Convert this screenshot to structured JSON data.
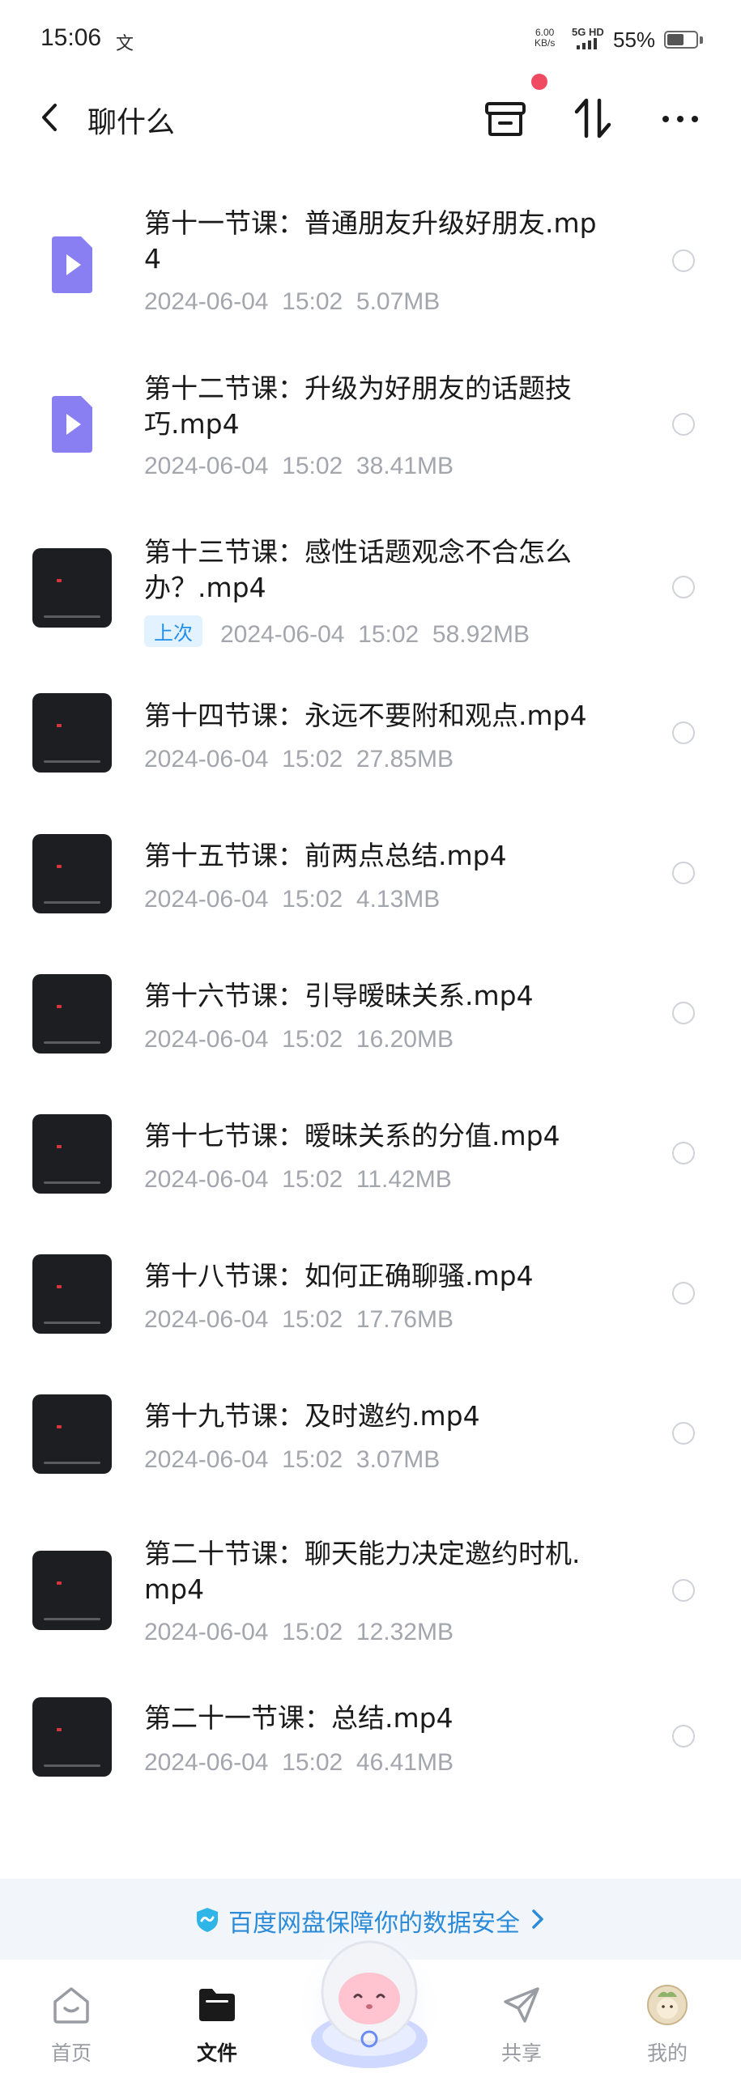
{
  "status_bar": {
    "time": "15:06",
    "notif_icon": "文",
    "net_speed_value": "6.00",
    "net_speed_unit": "KB/s",
    "signal": "5G HD",
    "battery": "55%"
  },
  "header": {
    "title": "聊什么"
  },
  "files": [
    {
      "name": "第十一节课：普通朋友升级好朋友.mp4",
      "date": "2024-06-04",
      "time": "15:02",
      "size": "5.07MB",
      "thumb": "doc-video-icon"
    },
    {
      "name": "第十二节课：升级为好朋友的话题技巧.mp4",
      "date": "2024-06-04",
      "time": "15:02",
      "size": "38.41MB",
      "thumb": "doc-video-icon"
    },
    {
      "name": "第十三节课：感性话题观念不合怎么办？.mp4",
      "date": "2024-06-04",
      "time": "15:02",
      "size": "58.92MB",
      "thumb": "video-thumbnail",
      "badge": "上次"
    },
    {
      "name": "第十四节课：永远不要附和观点.mp4",
      "date": "2024-06-04",
      "time": "15:02",
      "size": "27.85MB",
      "thumb": "video-thumbnail"
    },
    {
      "name": "第十五节课：前两点总结.mp4",
      "date": "2024-06-04",
      "time": "15:02",
      "size": "4.13MB",
      "thumb": "video-thumbnail"
    },
    {
      "name": "第十六节课：引导暧昧关系.mp4",
      "date": "2024-06-04",
      "time": "15:02",
      "size": "16.20MB",
      "thumb": "video-thumbnail"
    },
    {
      "name": "第十七节课：暧昧关系的分值.mp4",
      "date": "2024-06-04",
      "time": "15:02",
      "size": "11.42MB",
      "thumb": "video-thumbnail"
    },
    {
      "name": "第十八节课：如何正确聊骚.mp4",
      "date": "2024-06-04",
      "time": "15:02",
      "size": "17.76MB",
      "thumb": "video-thumbnail"
    },
    {
      "name": "第十九节课：及时邀约.mp4",
      "date": "2024-06-04",
      "time": "15:02",
      "size": "3.07MB",
      "thumb": "video-thumbnail"
    },
    {
      "name": "第二十节课：聊天能力决定邀约时机.mp4",
      "date": "2024-06-04",
      "time": "15:02",
      "size": "12.32MB",
      "thumb": "video-thumbnail"
    },
    {
      "name": "第二十一节课：总结.mp4",
      "date": "2024-06-04",
      "time": "15:02",
      "size": "46.41MB",
      "thumb": "video-thumbnail"
    }
  ],
  "security_banner": {
    "text": "百度网盘保障你的数据安全",
    "icon": "shield-icon"
  },
  "bottom_nav": {
    "home": "首页",
    "files": "文件",
    "share": "共享",
    "mine": "我的"
  },
  "colors": {
    "accent": "#1f8eea",
    "doc_icon": "#8a7ff2",
    "meta_text": "#a3a6ad",
    "notification_dot": "#f04a62"
  }
}
